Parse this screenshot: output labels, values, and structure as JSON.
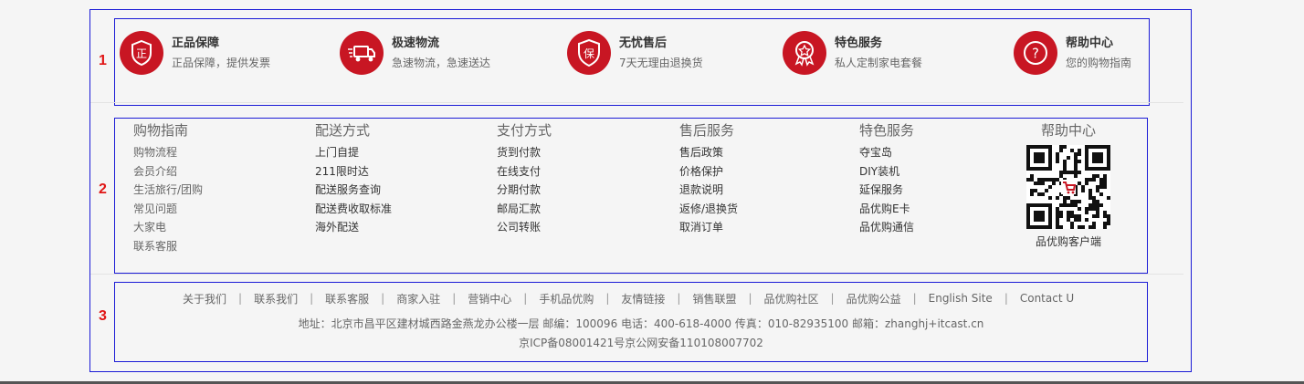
{
  "markers": [
    "1",
    "2",
    "3"
  ],
  "accent_color": "#c81623",
  "frame_color": "#1a1ad6",
  "promises": [
    {
      "icon": "authentic-icon",
      "glyph": "正",
      "title": "正品保障",
      "sub": "正品保障，提供发票"
    },
    {
      "icon": "delivery-truck-icon",
      "glyph": "",
      "title": "极速物流",
      "sub": "急速物流，急速送达"
    },
    {
      "icon": "shield-icon",
      "glyph": "保",
      "title": "无忧售后",
      "sub": "7天无理由退换货"
    },
    {
      "icon": "award-badge-icon",
      "glyph": "",
      "title": "特色服务",
      "sub": "私人定制家电套餐"
    },
    {
      "icon": "question-icon",
      "glyph": "?",
      "title": "帮助中心",
      "sub": "您的购物指南"
    }
  ],
  "columns": [
    {
      "title": "购物指南",
      "links": [
        "购物流程",
        "会员介绍",
        "生活旅行/团购",
        "常见问题",
        "大家电",
        "联系客服"
      ]
    },
    {
      "title": "配送方式",
      "links": [
        "上门自提",
        "211限时达",
        "配送服务查询",
        "配送费收取标准",
        "海外配送"
      ]
    },
    {
      "title": "支付方式",
      "links": [
        "货到付款",
        "在线支付",
        "分期付款",
        "邮局汇款",
        "公司转账"
      ]
    },
    {
      "title": "售后服务",
      "links": [
        "售后政策",
        "价格保护",
        "退款说明",
        "返修/退换货",
        "取消订单"
      ]
    },
    {
      "title": "特色服务",
      "links": [
        "夺宝岛",
        "DIY装机",
        "延保服务",
        "品优购E卡",
        "品优购通信"
      ]
    }
  ],
  "help": {
    "title": "帮助中心",
    "qr_caption": "品优购客户端"
  },
  "footer_nav": [
    "关于我们",
    "联系我们",
    "联系客服",
    "商家入驻",
    "营销中心",
    "手机品优购",
    "友情链接",
    "销售联盟",
    "品优购社区",
    "品优购公益",
    "English Site",
    "Contact U"
  ],
  "footer_separator": "|",
  "address": "地址：北京市昌平区建材城西路金燕龙办公楼一层 邮编：100096 电话：400-618-4000 传真：010-82935100 邮箱：zhanghj+itcast.cn",
  "icp": "京ICP备08001421号京公网安备110108007702"
}
